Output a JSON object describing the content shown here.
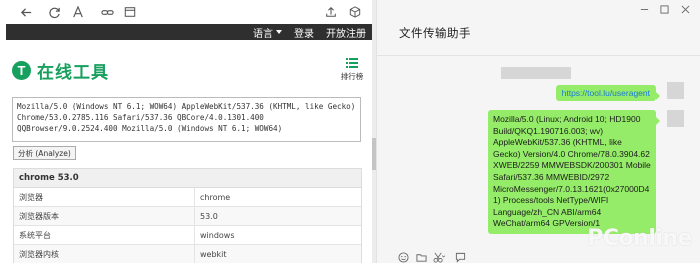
{
  "browser": {
    "toolbar_icons": [
      "back-icon",
      "refresh-icon",
      "text-size-icon",
      "link-icon",
      "tabs-icon",
      "share-icon",
      "box-icon"
    ],
    "nav": {
      "language": "语言",
      "login": "登录",
      "register": "开放注册"
    },
    "logo": {
      "badge": "T",
      "title": "在线工具"
    },
    "rank_label": "排行榜",
    "ua_text": "Mozilla/5.0 (Windows NT 6.1; WOW64) AppleWebKit/537.36 (KHTML, like Gecko) Chrome/53.0.2785.116 Safari/537.36 QBCore/4.0.1301.400 QQBrowser/9.0.2524.400 Mozilla/5.0 (Windows NT 6.1; WOW64)",
    "analyze_label": "分析 (Analyze)",
    "result": {
      "title": "chrome 53.0",
      "rows": [
        {
          "key": "浏览器",
          "value": "chrome"
        },
        {
          "key": "浏览器版本",
          "value": "53.0"
        },
        {
          "key": "系统平台",
          "value": "windows"
        },
        {
          "key": "浏览器内核",
          "value": "webkit"
        }
      ]
    }
  },
  "chat": {
    "title": "文件传输助手",
    "window_controls": [
      "minimize-icon",
      "maximize-icon",
      "close-icon"
    ],
    "link_message": "https://tool.lu/useragent",
    "ua_message": "Mozilla/5.0 (Linux; Android 10; HD1900 Build/QKQ1.190716.003; wv) AppleWebKit/537.36 (KHTML, like Gecko) Version/4.0 Chrome/78.0.3904.62 XWEB/2259 MMWEBSDK/200301 Mobile Safari/537.36 MMWEBID/2972 MicroMessenger/7.0.13.1621(0x27000D41) Process/tools NetType/WIFI Language/zh_CN ABI/arm64 WeChat/arm64 GPVersion/1",
    "input_icons": [
      "emoji-icon",
      "folder-icon",
      "scissors-icon",
      "chat-history-icon"
    ],
    "watermark": "PConline"
  }
}
